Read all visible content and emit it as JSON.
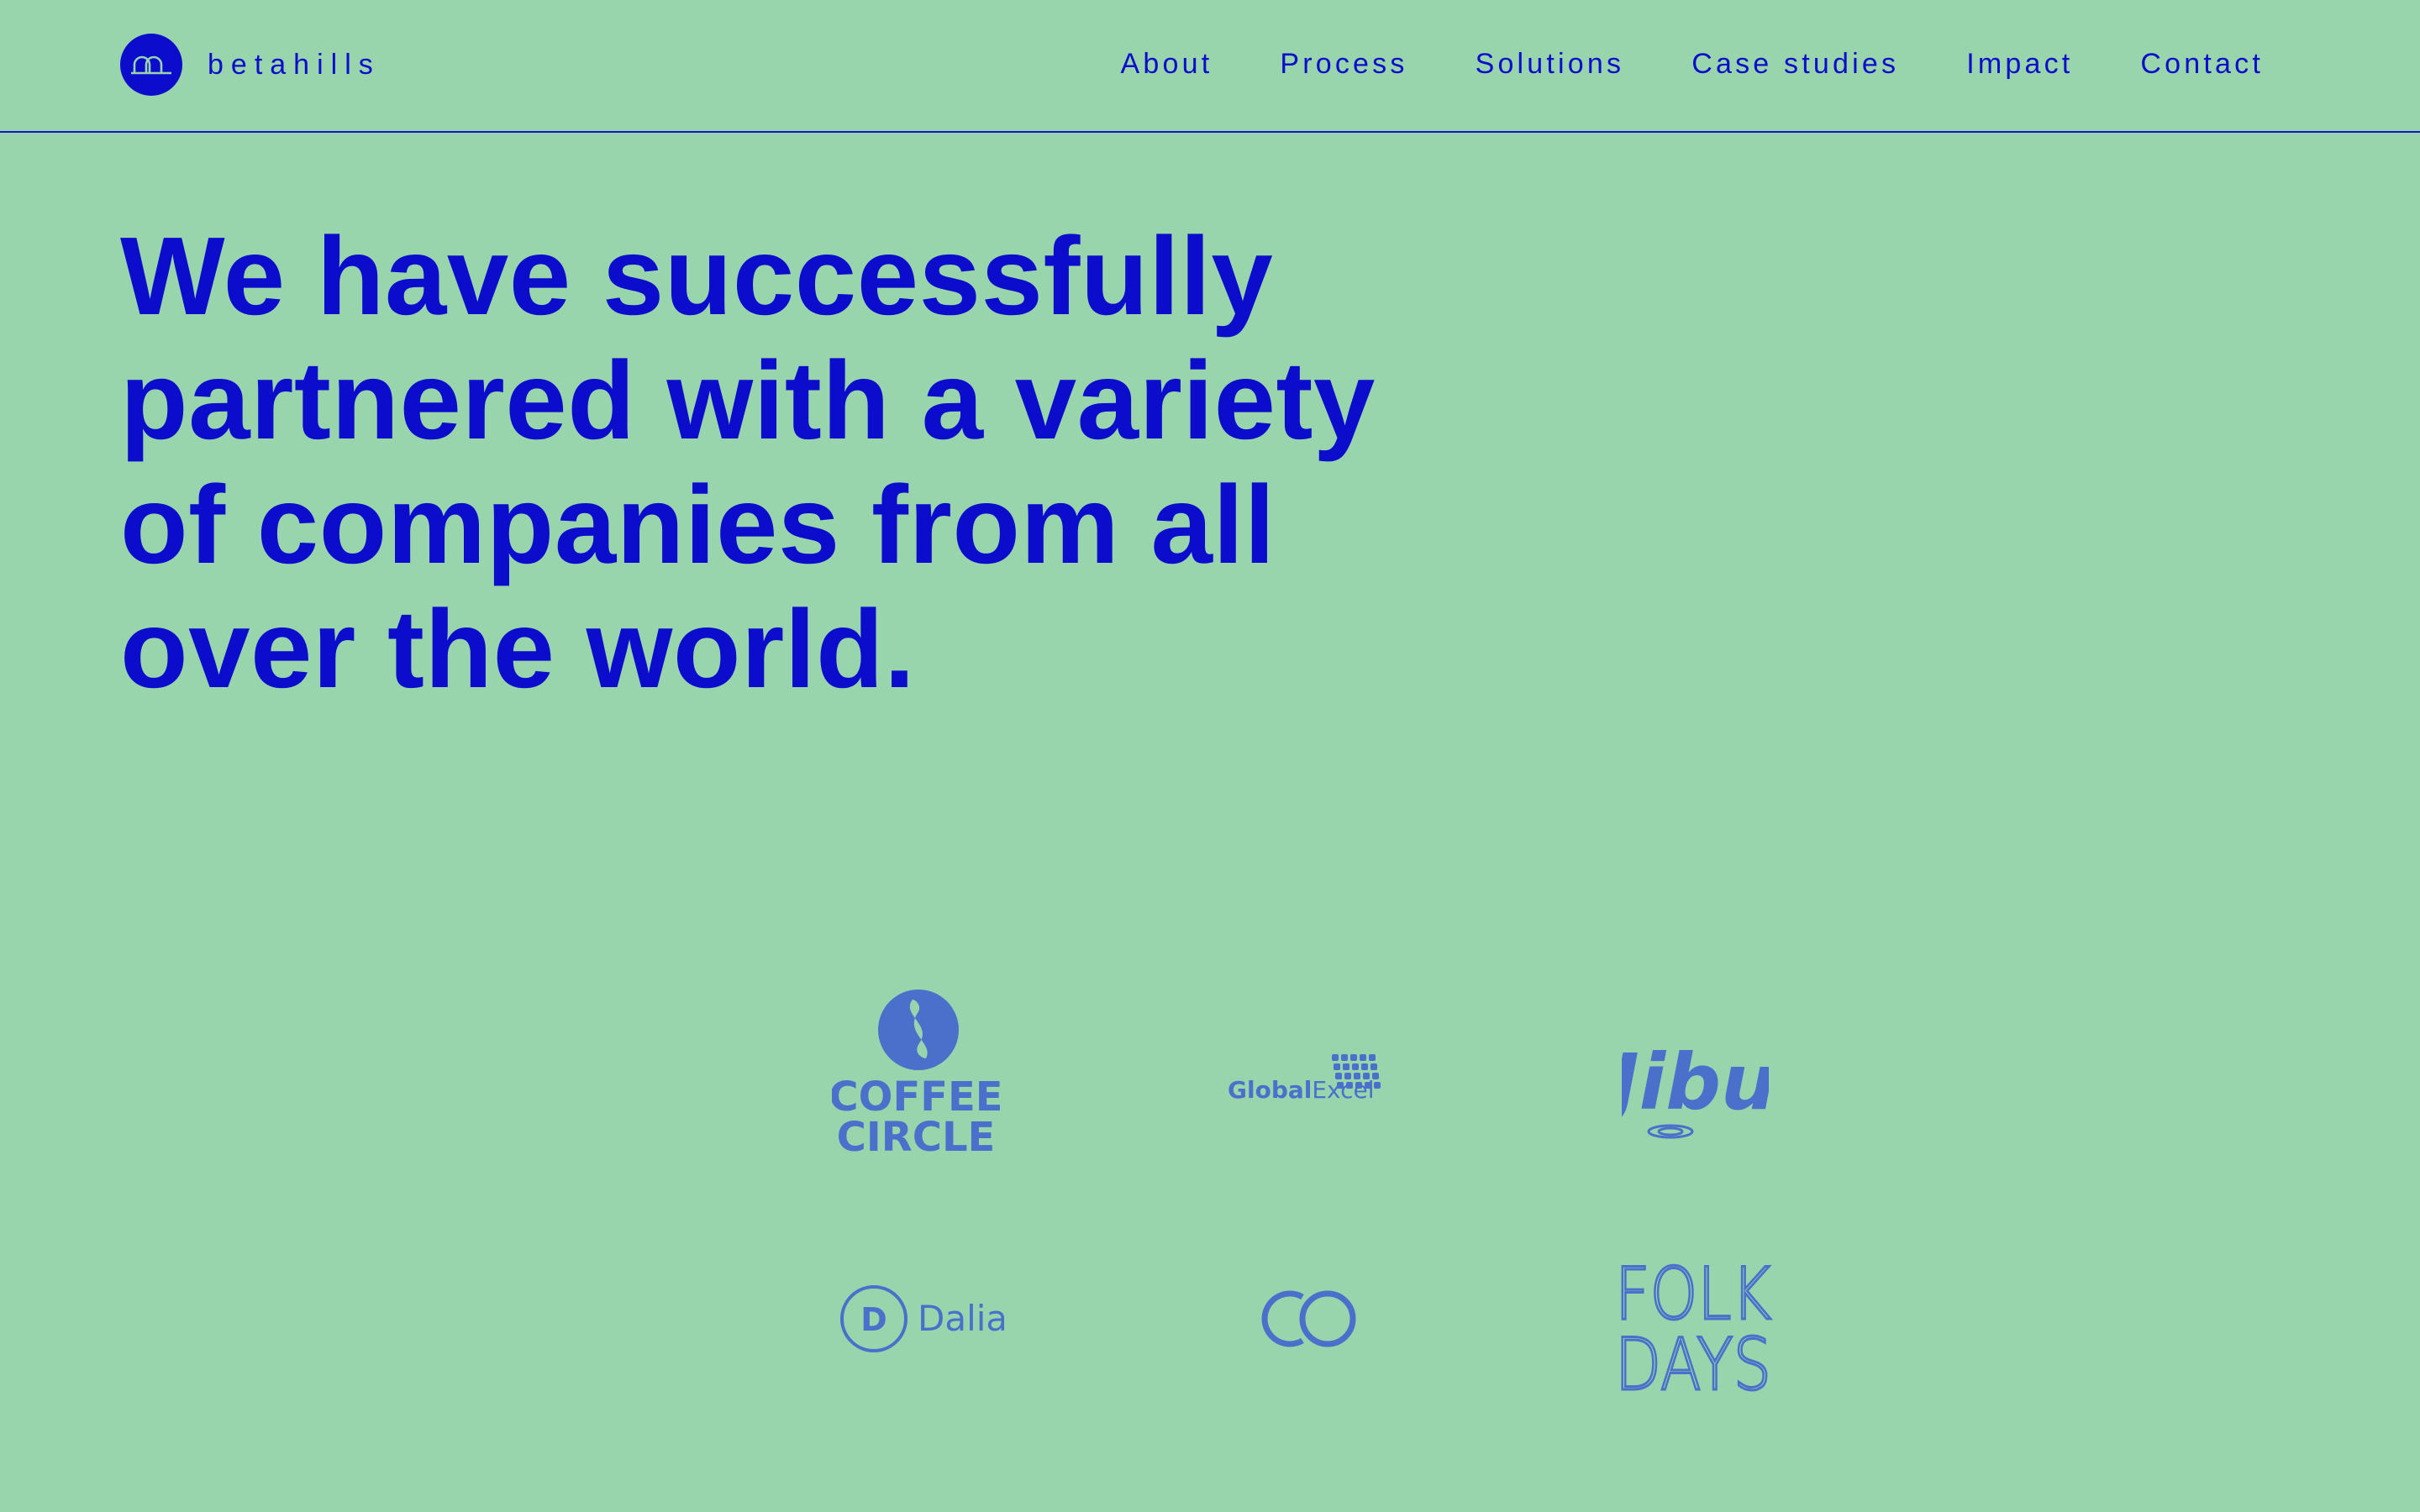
{
  "brand": {
    "name": "betahills",
    "logo_icon": "hills-arch-icon"
  },
  "nav": {
    "items": [
      {
        "label": "About"
      },
      {
        "label": "Process"
      },
      {
        "label": "Solutions"
      },
      {
        "label": "Case studies"
      },
      {
        "label": "Impact"
      },
      {
        "label": "Contact"
      }
    ]
  },
  "hero": {
    "headline_lines": [
      "We have successfully",
      "partnered with a variety",
      "of companies from all",
      "over the world."
    ]
  },
  "clients": {
    "logos": [
      {
        "name": "COFFEE CIRCLE",
        "line1": "COFFEE",
        "line2": "CIRCLE"
      },
      {
        "name": "GlobalExcel",
        "part1": "Global",
        "part2": "Excel"
      },
      {
        "name": "Jibu"
      },
      {
        "name": "Dalia",
        "mark": "D"
      },
      {
        "name": "CO"
      },
      {
        "name": "FOLK DAYS",
        "line1": "FOLK",
        "line2": "DAYS"
      }
    ]
  },
  "colors": {
    "background": "#98d4ac",
    "primary": "#0c0ccc",
    "logo": "#4a70cc"
  }
}
